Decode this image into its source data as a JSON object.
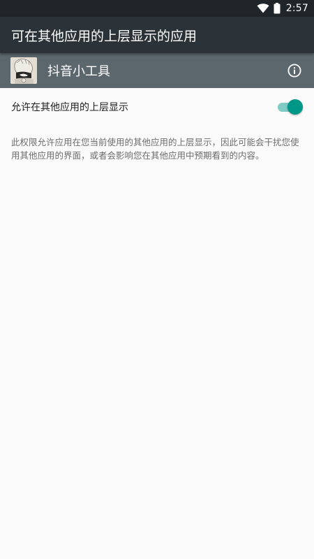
{
  "status_bar": {
    "time": "2:57",
    "icons": [
      "wifi-icon",
      "battery-icon"
    ]
  },
  "toolbar": {
    "title": "可在其他应用的上层显示的应用"
  },
  "app_header": {
    "name": "抖音小工具",
    "icon": "app-icon",
    "info_icon": "info-icon",
    "background_color": "#5b676d"
  },
  "setting": {
    "label": "允许在其他应用的上层显示",
    "toggle_on": true,
    "accent_color": "#009688"
  },
  "description": "此权限允许应用在您当前使用的其他应用的上层显示，因此可能会干扰您使用其他应用的界面，或者会影响您在其他应用中预期看到的内容。"
}
